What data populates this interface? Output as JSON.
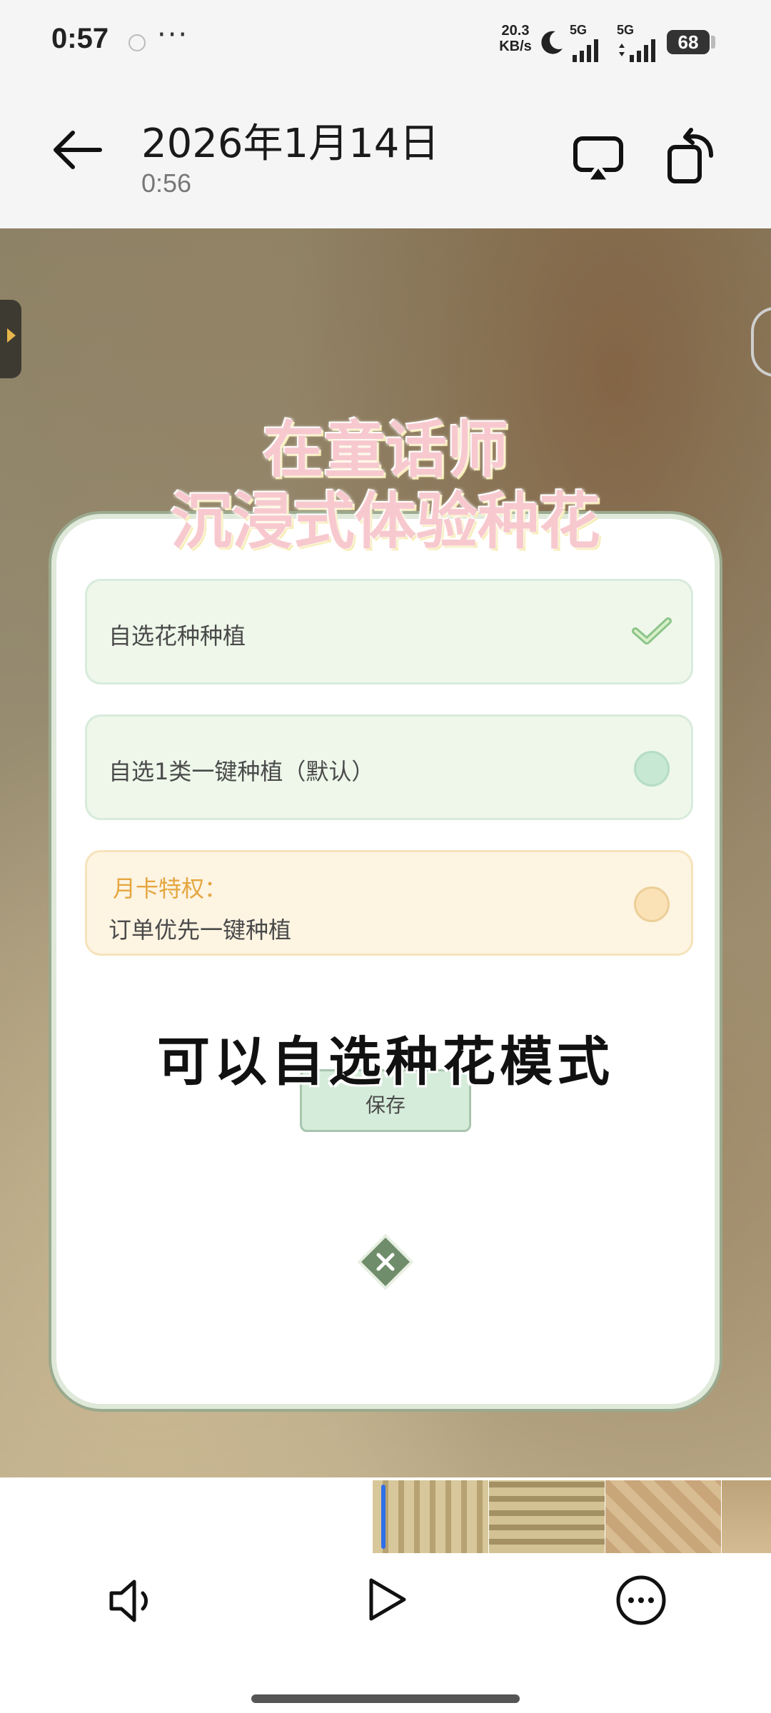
{
  "status_bar": {
    "time": "0:57",
    "dots": "···",
    "net_speed_value": "20.3",
    "net_speed_unit": "KB/s",
    "signal1_label": "5G",
    "signal2_label": "5G",
    "battery": "68"
  },
  "header": {
    "title": "2026年1月14日",
    "subtitle": "0:56"
  },
  "video": {
    "overlay_line1": "在童话师",
    "overlay_line2": "沉浸式体验种花",
    "options": [
      {
        "label": "自选花种种植",
        "selected": true
      },
      {
        "label": "自选1类一键种植（默认）",
        "selected": false
      }
    ],
    "monthly_title": "月卡特权：",
    "monthly_label": "订单优先一键种植",
    "caption": "可以自选种花模式",
    "save_label": "保存"
  },
  "colors": {
    "accent_green": "#8cc48a",
    "accent_yellow": "#e5a63f",
    "progress_blue": "#2f6fe8"
  },
  "icons": [
    "back-arrow-icon",
    "cast-icon",
    "rotate-icon",
    "check-icon",
    "close-icon",
    "volume-icon",
    "play-icon",
    "more-icon"
  ]
}
